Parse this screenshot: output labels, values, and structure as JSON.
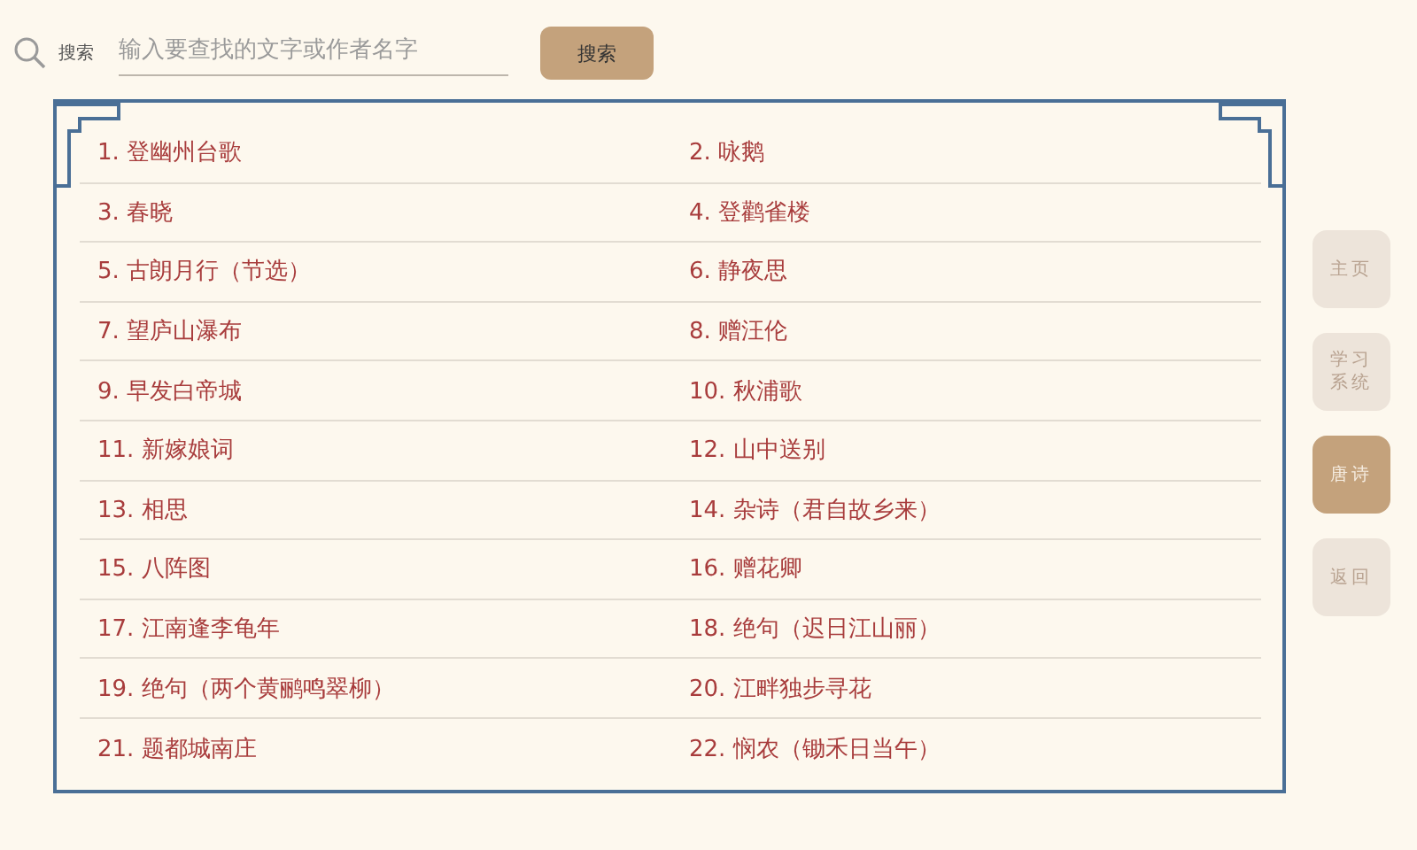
{
  "search": {
    "label": "搜索",
    "placeholder": "输入要查找的文字或作者名字",
    "button": "搜索"
  },
  "poems": [
    "1. 登幽州台歌",
    "2. 咏鹅",
    "3. 春晓",
    "4. 登鹳雀楼",
    "5. 古朗月行（节选）",
    "6. 静夜思",
    "7. 望庐山瀑布",
    "8. 赠汪伦",
    "9. 早发白帝城",
    "10. 秋浦歌",
    "11. 新嫁娘词",
    "12. 山中送别",
    "13. 相思",
    "14. 杂诗（君自故乡来）",
    "15. 八阵图",
    "16. 赠花卿",
    "17. 江南逢李龟年",
    "18. 绝句（迟日江山丽）",
    "19. 绝句（两个黄鹂鸣翠柳）",
    "20. 江畔独步寻花",
    "21. 题都城南庄",
    "22. 悯农（锄禾日当午）"
  ],
  "nav": [
    {
      "label": "主页",
      "selected": false
    },
    {
      "label": "学习系统",
      "selected": false
    },
    {
      "label": "唐诗",
      "selected": true
    },
    {
      "label": "返回",
      "selected": false
    }
  ]
}
